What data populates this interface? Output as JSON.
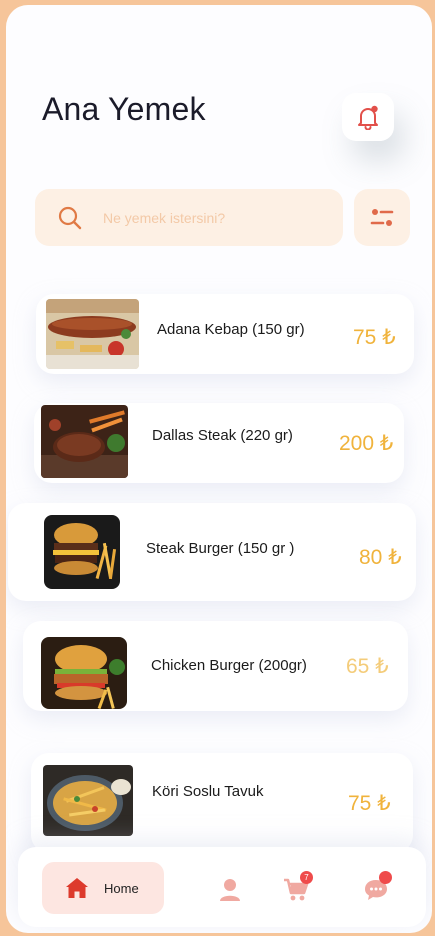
{
  "header": {
    "title": "Ana Yemek"
  },
  "search": {
    "placeholder": "Ne yemek istersini?"
  },
  "menu_items": [
    {
      "name": "Adana Kebap (150 gr)",
      "price": "75 ₺"
    },
    {
      "name": "Dallas Steak (220 gr)",
      "price": "200 ₺"
    },
    {
      "name": "Steak Burger (150 gr )",
      "price": "80 ₺"
    },
    {
      "name": "Chicken Burger (200gr)",
      "price": "65 ₺"
    },
    {
      "name": "Köri Soslu Tavuk",
      "price": "75 ₺"
    }
  ],
  "bottom_nav": {
    "home_label": "Home",
    "cart_badge": "7"
  },
  "colors": {
    "accent": "#ef4b4b",
    "price": "#f0b33c",
    "search_bg": "#fdf0e4",
    "frame": "#f6c59a"
  },
  "icons": [
    "bell-icon",
    "search-icon",
    "filter-icon",
    "home-icon",
    "profile-icon",
    "cart-icon",
    "chat-icon"
  ]
}
